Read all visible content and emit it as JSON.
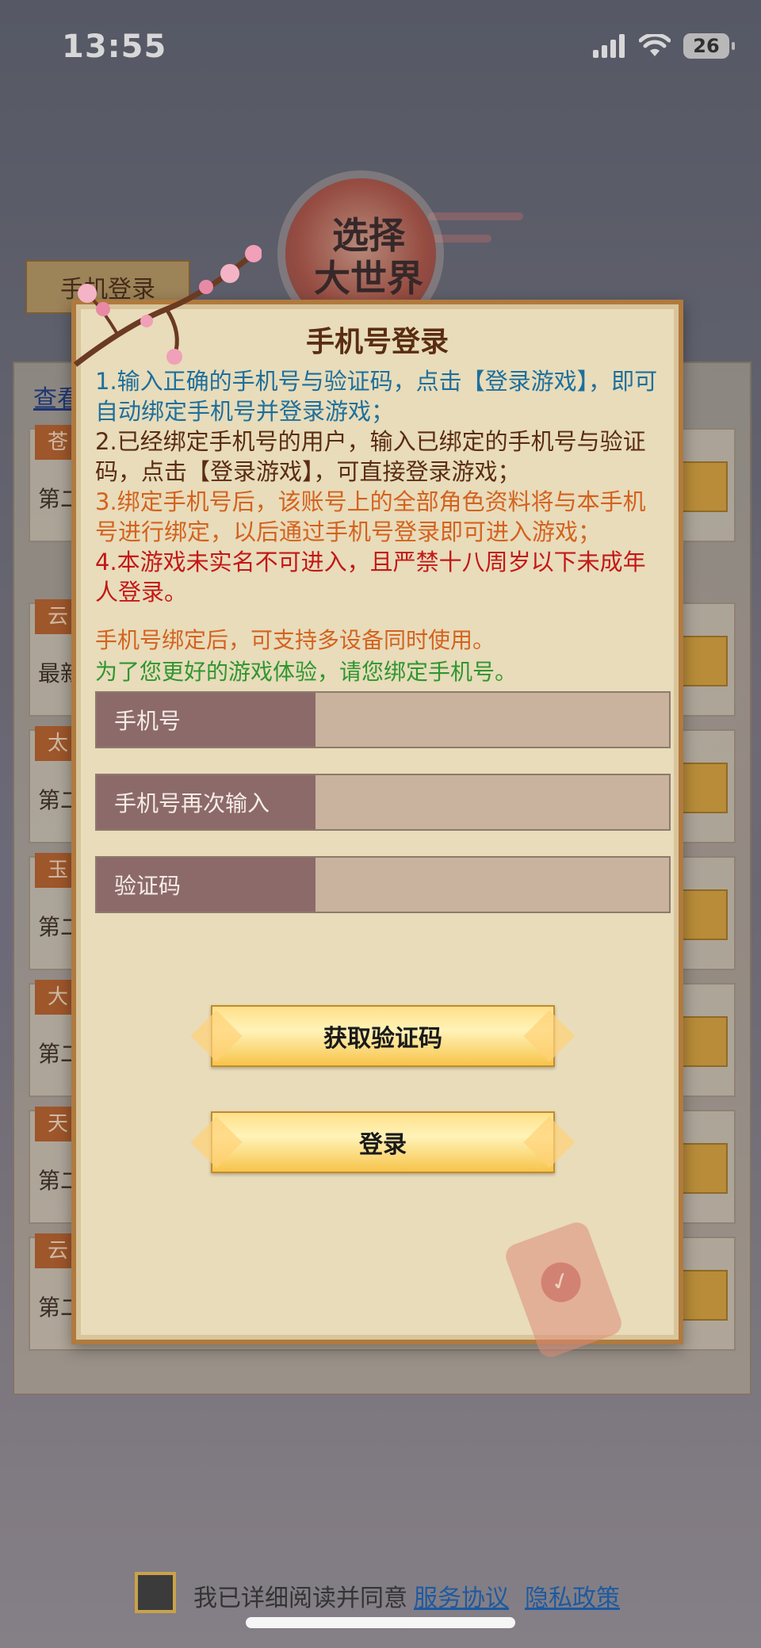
{
  "status": {
    "time": "13:55",
    "battery": "26"
  },
  "background": {
    "emblem_text": "选择\n大世界",
    "tab_label": "手机登录",
    "link_text": "查看",
    "rows": [
      {
        "tag": "苍",
        "name": "第二"
      },
      {
        "tag": "云",
        "name": "最新"
      },
      {
        "tag": "太",
        "name": "第二"
      },
      {
        "tag": "玉",
        "name": "第二"
      },
      {
        "tag": "大",
        "name": "第二"
      },
      {
        "tag": "天",
        "name": "第二"
      },
      {
        "tag": "云",
        "name": "第二"
      }
    ]
  },
  "modal": {
    "title": "手机号登录",
    "rules": [
      "1.输入正确的手机号与验证码，点击【登录游戏】，即可自动绑定手机号并登录游戏；",
      "2.已经绑定手机号的用户，输入已绑定的手机号与验证码，点击【登录游戏】，可直接登录游戏；",
      "3.绑定手机号后，该账号上的全部角色资料将与本手机号进行绑定，以后通过手机号登录即可进入游戏；",
      "4.本游戏未实名不可进入，且严禁十八周岁以下未成年人登录。"
    ],
    "note_multi_device": "手机号绑定后，可支持多设备同时使用。",
    "note_bind": "为了您更好的游戏体验，请您绑定手机号。",
    "fields": {
      "phone_label": "手机号",
      "phone_value": "",
      "phone_again_label": "手机号再次输入",
      "phone_again_value": "",
      "code_label": "验证码",
      "code_value": ""
    },
    "get_code_button": "获取验证码",
    "login_button": "登录"
  },
  "agreement": {
    "text": "我已详细阅读并同意",
    "service_link": "服务协议",
    "privacy_link": "隐私政策"
  },
  "colors": {
    "modal_bg": "#e8dcba",
    "modal_border": "#b07a3e",
    "rule_blue": "#1e6f9c",
    "rule_dark": "#5a2d12",
    "rule_orange": "#d4621f",
    "rule_red": "#c31818",
    "note_green": "#2f9630",
    "field_label_bg": "#8c6a6a",
    "field_input_bg": "#c9b29e"
  }
}
